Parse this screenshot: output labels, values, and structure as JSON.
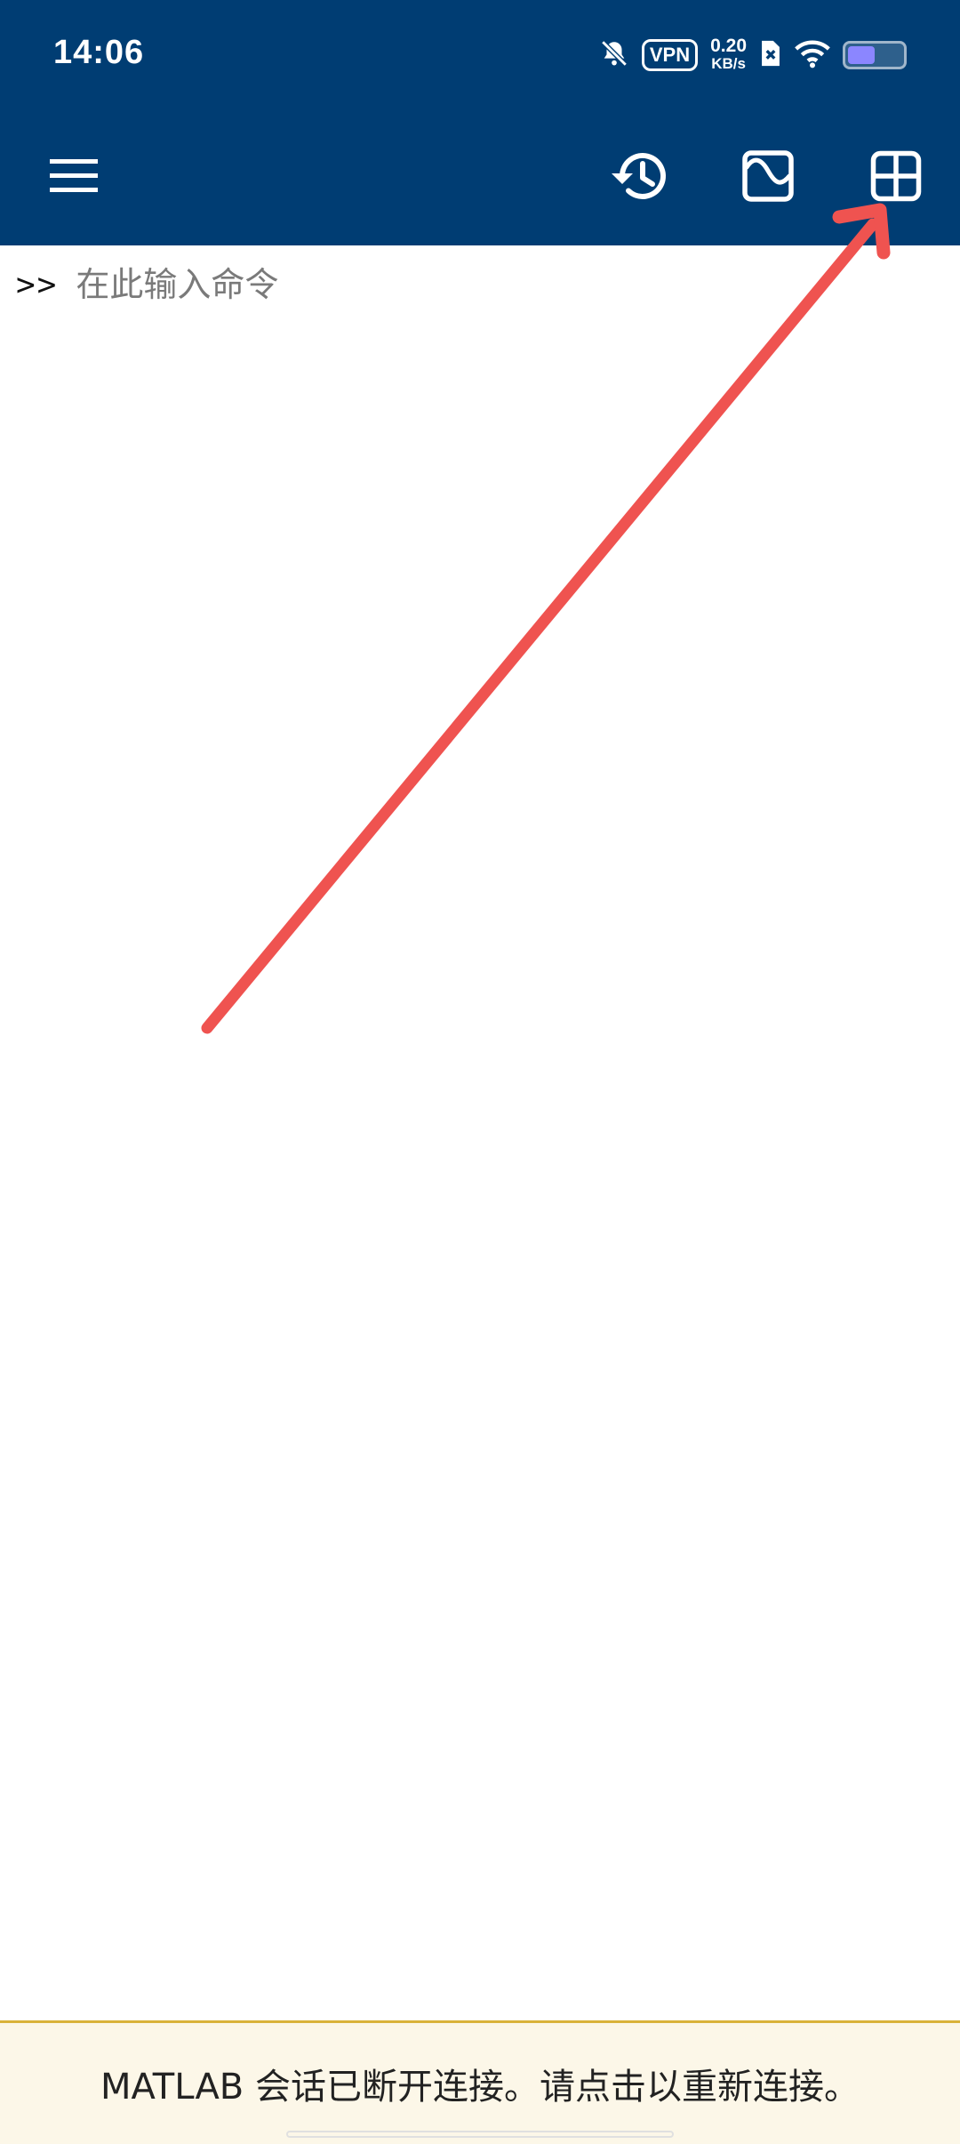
{
  "status_bar": {
    "time": "14:06",
    "vpn_label": "VPN",
    "net_speed_value": "0.20",
    "net_speed_unit": "KB/s",
    "icons": [
      "bell-muted-icon",
      "vpn-icon",
      "sim-no-signal-icon",
      "wifi-icon",
      "battery-icon"
    ]
  },
  "toolbar": {
    "icons": [
      "menu-icon",
      "history-icon",
      "plot-icon",
      "workspace-grid-icon"
    ]
  },
  "command": {
    "prompt": ">>",
    "placeholder": "在此输入命令",
    "value": ""
  },
  "banner": {
    "text": "MATLAB 会话已断开连接。请点击以重新连接。"
  },
  "colors": {
    "header_bg": "#003d73",
    "banner_bg": "#fcf7e8",
    "banner_border": "#d9b23a",
    "annotation_arrow": "#ef5350"
  }
}
